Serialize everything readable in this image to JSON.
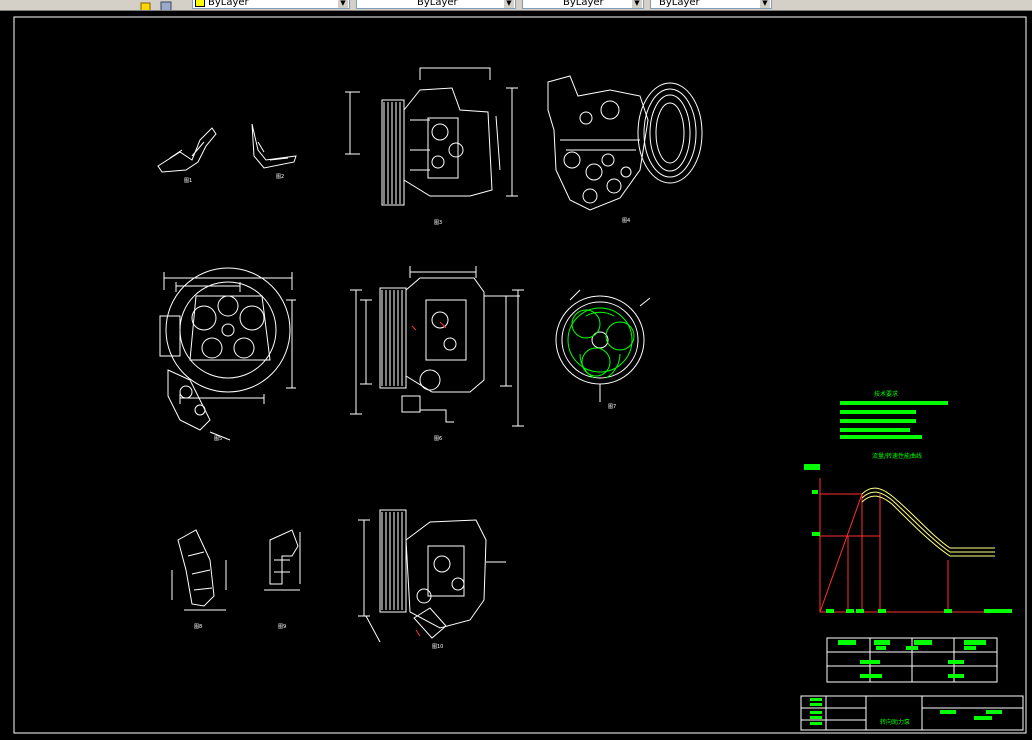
{
  "toolbar": {
    "combos": [
      {
        "label": "ByLayer",
        "swatch": true
      },
      {
        "label": "ByLayer",
        "swatch": false
      },
      {
        "label": "ByLayer",
        "swatch": false
      },
      {
        "label": "ByLayer",
        "swatch": false
      }
    ]
  },
  "drawing": {
    "view_labels": [
      "图1",
      "图2",
      "图3",
      "图4",
      "图5",
      "图6",
      "图7",
      "图8",
      "图9",
      "图10",
      "图11"
    ],
    "tech_req_title": "技术要求",
    "chart_title": "流量/转速性能曲线",
    "title_block_name": "转向助力泵"
  },
  "colors": {
    "background": "#000000",
    "line": "#ffffff",
    "highlight": "#00ff00",
    "curve": "#ffff80",
    "axis": "#ff3030",
    "table": "#ffffff"
  }
}
